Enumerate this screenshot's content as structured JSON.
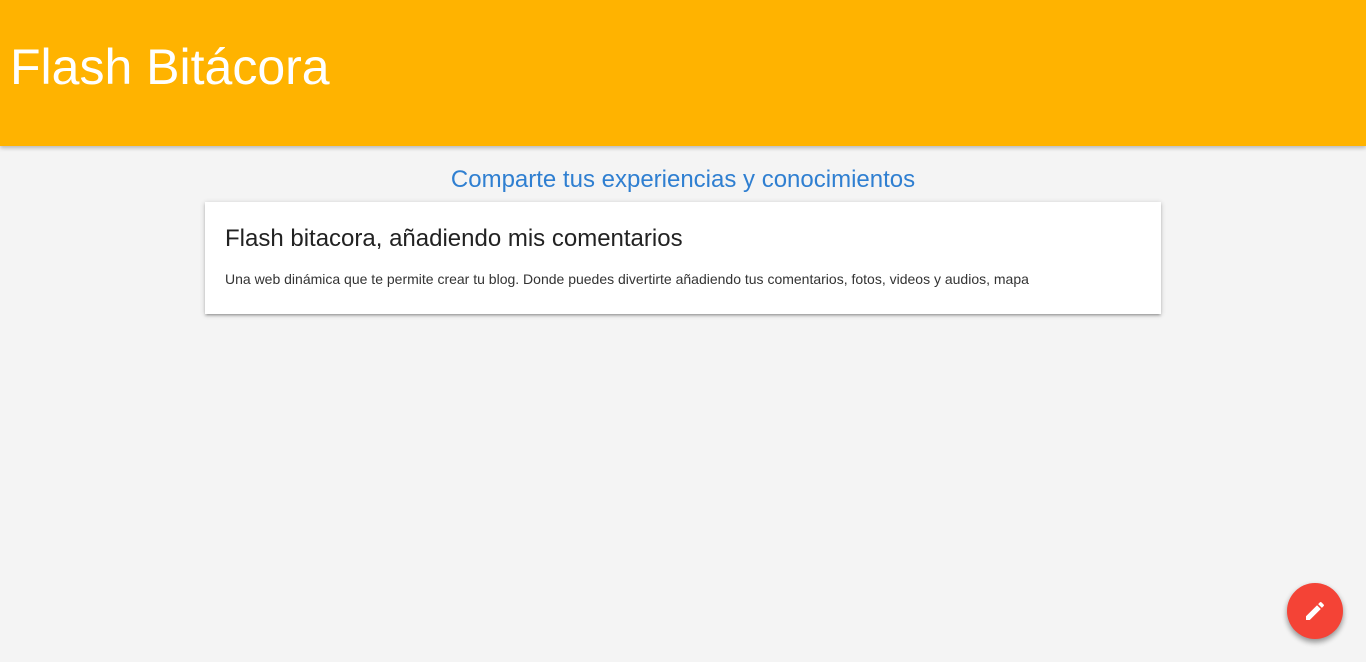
{
  "header": {
    "title": "Flash Bitácora",
    "background_color": "#ffb300"
  },
  "main": {
    "subtitle": "Comparte tus experiencias y conocimientos",
    "subtitle_color": "#2f7fd1",
    "card": {
      "title": "Flash bitacora, añadiendo mis comentarios",
      "text": "Una web dinámica que te permite crear tu blog. Donde puedes divertirte añadiendo tus comentarios, fotos, videos y audios, mapa"
    }
  },
  "fab": {
    "icon": "pencil-icon",
    "color": "#f44336"
  }
}
